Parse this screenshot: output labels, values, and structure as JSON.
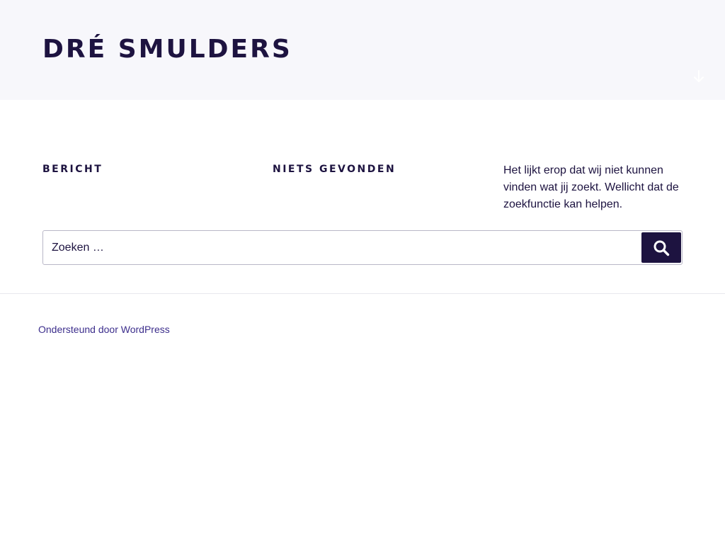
{
  "header": {
    "site_title": "DRÉ SMULDERS",
    "background_color": "#f7f7fb",
    "title_color": "#1d1340",
    "scroll_icon": "arrow-down-icon"
  },
  "main": {
    "page_label": "BERICHT",
    "page_title": "NIETS GEVONDEN",
    "message": "Het lijkt erop dat wij niet kunnen vinden wat jij zoekt. Wellicht dat de zoekfunctie kan helpen.",
    "search": {
      "placeholder": "Zoeken …",
      "value": "",
      "button_icon": "search-icon",
      "button_color": "#1d1340"
    }
  },
  "footer": {
    "credit": "Ondersteund door WordPress",
    "link_color": "#3c2e8c"
  }
}
